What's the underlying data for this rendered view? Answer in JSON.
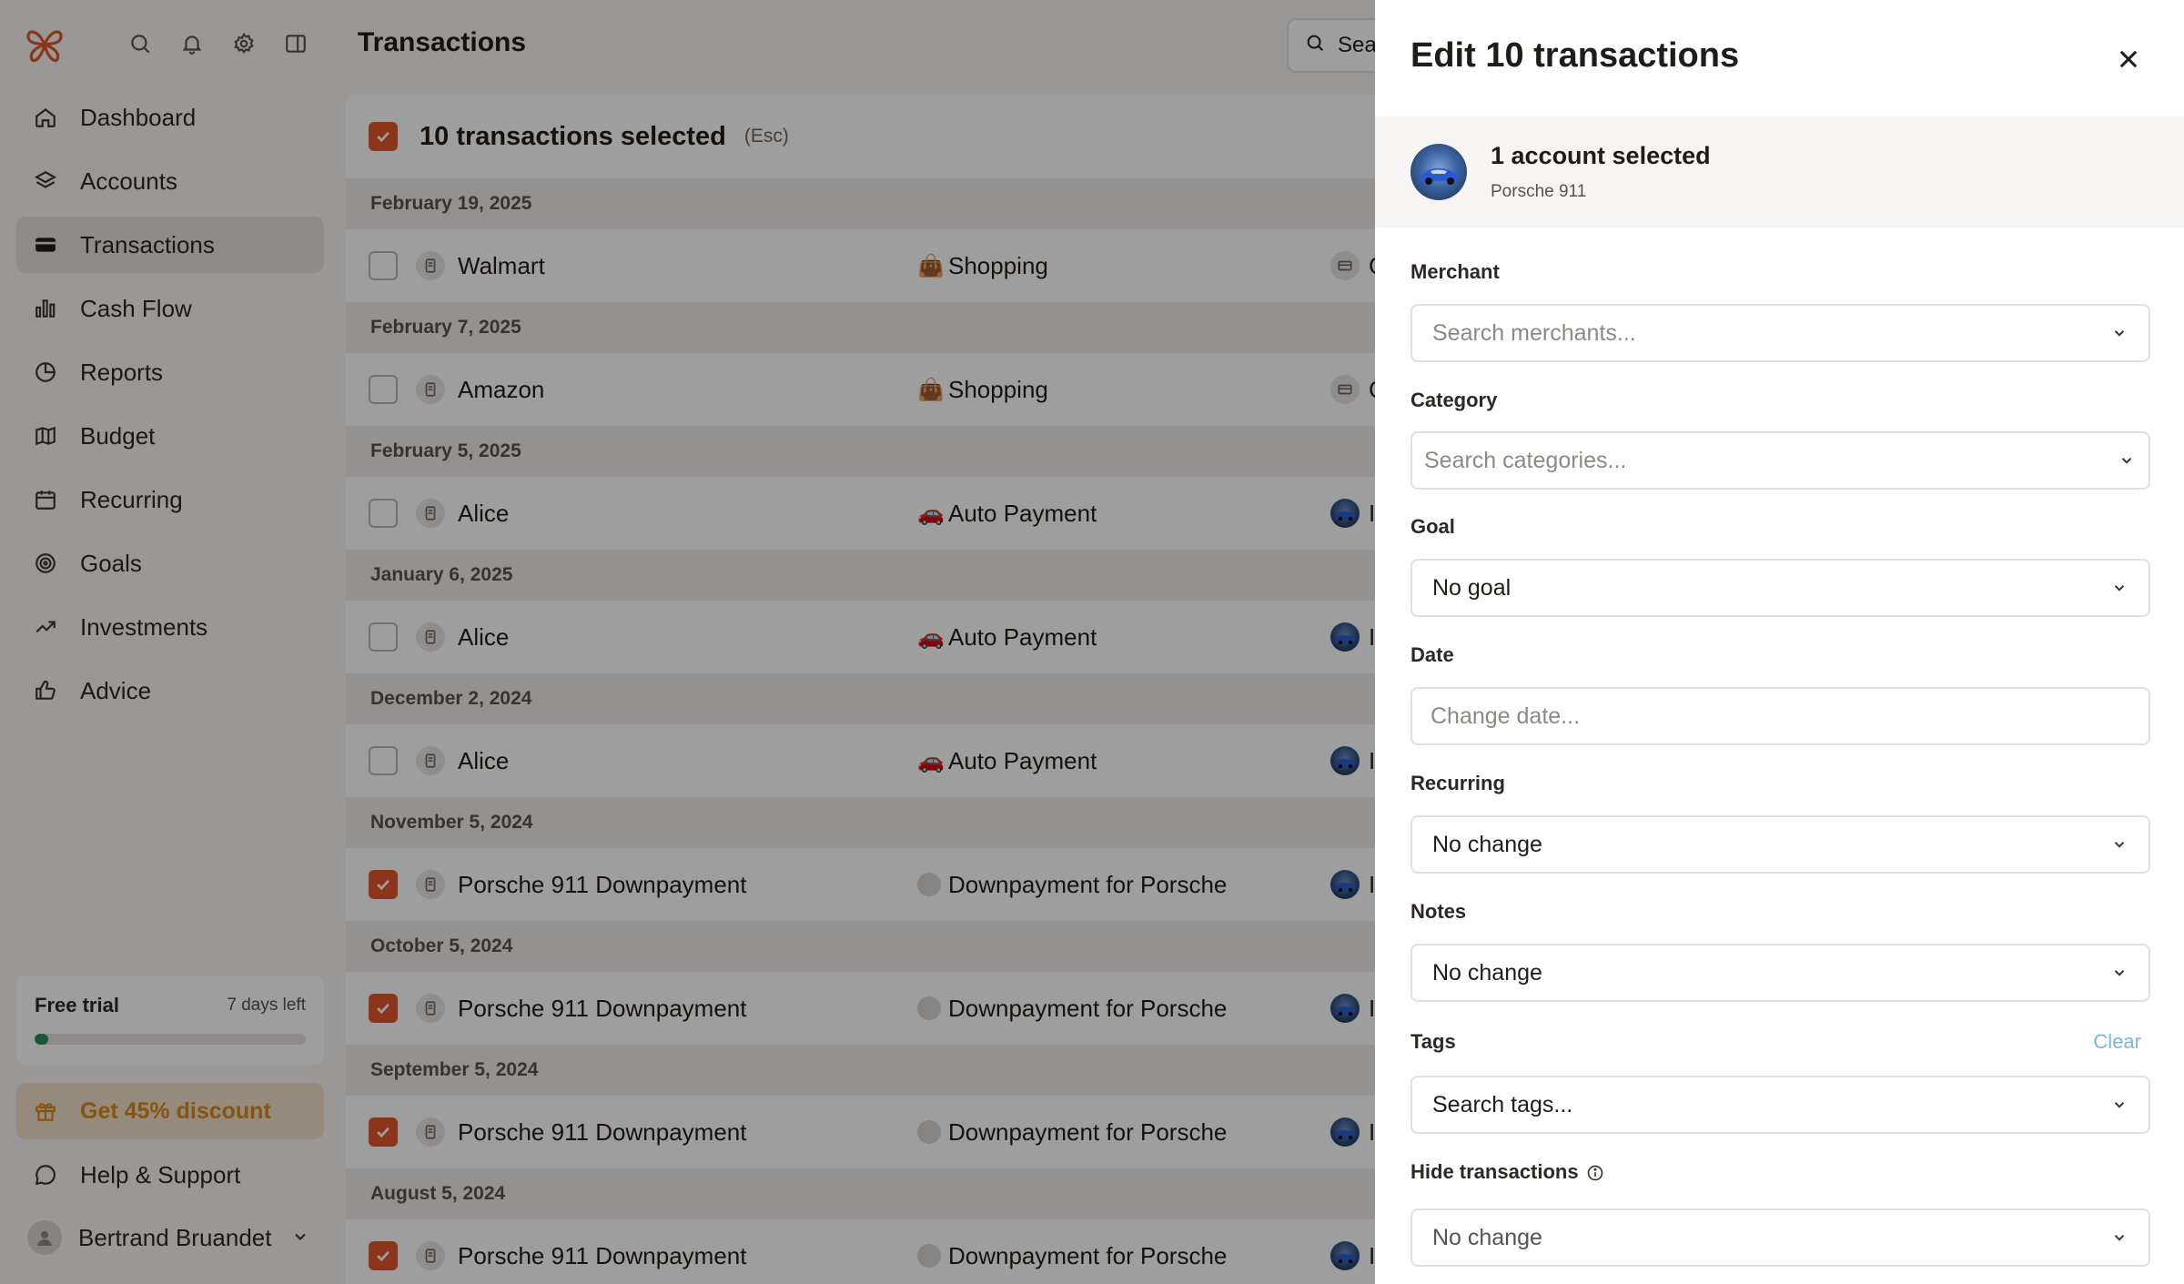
{
  "sidebar": {
    "nav": [
      {
        "label": "Dashboard",
        "icon": "home-icon",
        "active": false
      },
      {
        "label": "Accounts",
        "icon": "layers-icon",
        "active": false
      },
      {
        "label": "Transactions",
        "icon": "credit-card-icon",
        "active": true
      },
      {
        "label": "Cash Flow",
        "icon": "bar-chart-icon",
        "active": false
      },
      {
        "label": "Reports",
        "icon": "pie-chart-icon",
        "active": false
      },
      {
        "label": "Budget",
        "icon": "map-icon",
        "active": false
      },
      {
        "label": "Recurring",
        "icon": "calendar-icon",
        "active": false
      },
      {
        "label": "Goals",
        "icon": "target-icon",
        "active": false
      },
      {
        "label": "Investments",
        "icon": "trending-up-icon",
        "active": false
      },
      {
        "label": "Advice",
        "icon": "thumbs-up-icon",
        "active": false
      }
    ],
    "trial": {
      "title": "Free trial",
      "days_left": "7 days left",
      "progress": 0.05
    },
    "discount_label": "Get 45% discount",
    "help_label": "Help & Support",
    "user_name": "Bertrand Bruandet"
  },
  "main": {
    "title": "Transactions",
    "search_label": "Sea",
    "selection": {
      "title": "10 transactions selected",
      "hint": "(Esc)"
    },
    "groups": [
      {
        "date": "February 19, 2025",
        "rows": [
          {
            "merchant": "Walmart",
            "category": "Shopping",
            "cat_icon": "shopping-bag",
            "acct_icon": "card",
            "acct_text": "C",
            "checked": false
          }
        ]
      },
      {
        "date": "February 7, 2025",
        "rows": [
          {
            "merchant": "Amazon",
            "category": "Shopping",
            "cat_icon": "shopping-bag",
            "acct_icon": "card",
            "acct_text": "C",
            "checked": false
          }
        ]
      },
      {
        "date": "February 5, 2025",
        "rows": [
          {
            "merchant": "Alice",
            "category": "Auto Payment",
            "cat_icon": "car",
            "acct_icon": "car",
            "acct_text": "I",
            "checked": false
          }
        ]
      },
      {
        "date": "January 6, 2025",
        "rows": [
          {
            "merchant": "Alice",
            "category": "Auto Payment",
            "cat_icon": "car",
            "acct_icon": "car",
            "acct_text": "I",
            "checked": false
          }
        ]
      },
      {
        "date": "December 2, 2024",
        "rows": [
          {
            "merchant": "Alice",
            "category": "Auto Payment",
            "cat_icon": "car",
            "acct_icon": "car",
            "acct_text": "I",
            "checked": false
          }
        ]
      },
      {
        "date": "November 5, 2024",
        "rows": [
          {
            "merchant": "Porsche 911 Downpayment",
            "category": "Downpayment for Porsche",
            "cat_icon": "dot",
            "acct_icon": "car",
            "acct_text": "I",
            "checked": true
          }
        ]
      },
      {
        "date": "October 5, 2024",
        "rows": [
          {
            "merchant": "Porsche 911 Downpayment",
            "category": "Downpayment for Porsche",
            "cat_icon": "dot",
            "acct_icon": "car",
            "acct_text": "I",
            "checked": true
          }
        ]
      },
      {
        "date": "September 5, 2024",
        "rows": [
          {
            "merchant": "Porsche 911 Downpayment",
            "category": "Downpayment for Porsche",
            "cat_icon": "dot",
            "acct_icon": "car",
            "acct_text": "I",
            "checked": true
          }
        ]
      },
      {
        "date": "August 5, 2024",
        "rows": [
          {
            "merchant": "Porsche 911 Downpayment",
            "category": "Downpayment for Porsche",
            "cat_icon": "dot",
            "acct_icon": "car",
            "acct_text": "I",
            "checked": true
          }
        ]
      }
    ]
  },
  "drawer": {
    "title": "Edit 10 transactions",
    "account": {
      "title": "1 account selected",
      "name": "Porsche 911"
    },
    "fields": {
      "merchant": {
        "label": "Merchant",
        "placeholder": "Search merchants..."
      },
      "category": {
        "label": "Category",
        "placeholder": "Search categories..."
      },
      "goal": {
        "label": "Goal",
        "value": "No goal"
      },
      "date": {
        "label": "Date",
        "placeholder": "Change date..."
      },
      "recurring": {
        "label": "Recurring",
        "value": "No change"
      },
      "notes": {
        "label": "Notes",
        "value": "No change"
      },
      "tags": {
        "label": "Tags",
        "clear": "Clear",
        "placeholder": "Search tags..."
      },
      "hide": {
        "label": "Hide transactions",
        "value": "No change"
      }
    }
  },
  "colors": {
    "accent": "#e0562d",
    "discount_text": "#d7891d",
    "clear_link": "#7ab8d8",
    "progress": "#2e8b57"
  }
}
